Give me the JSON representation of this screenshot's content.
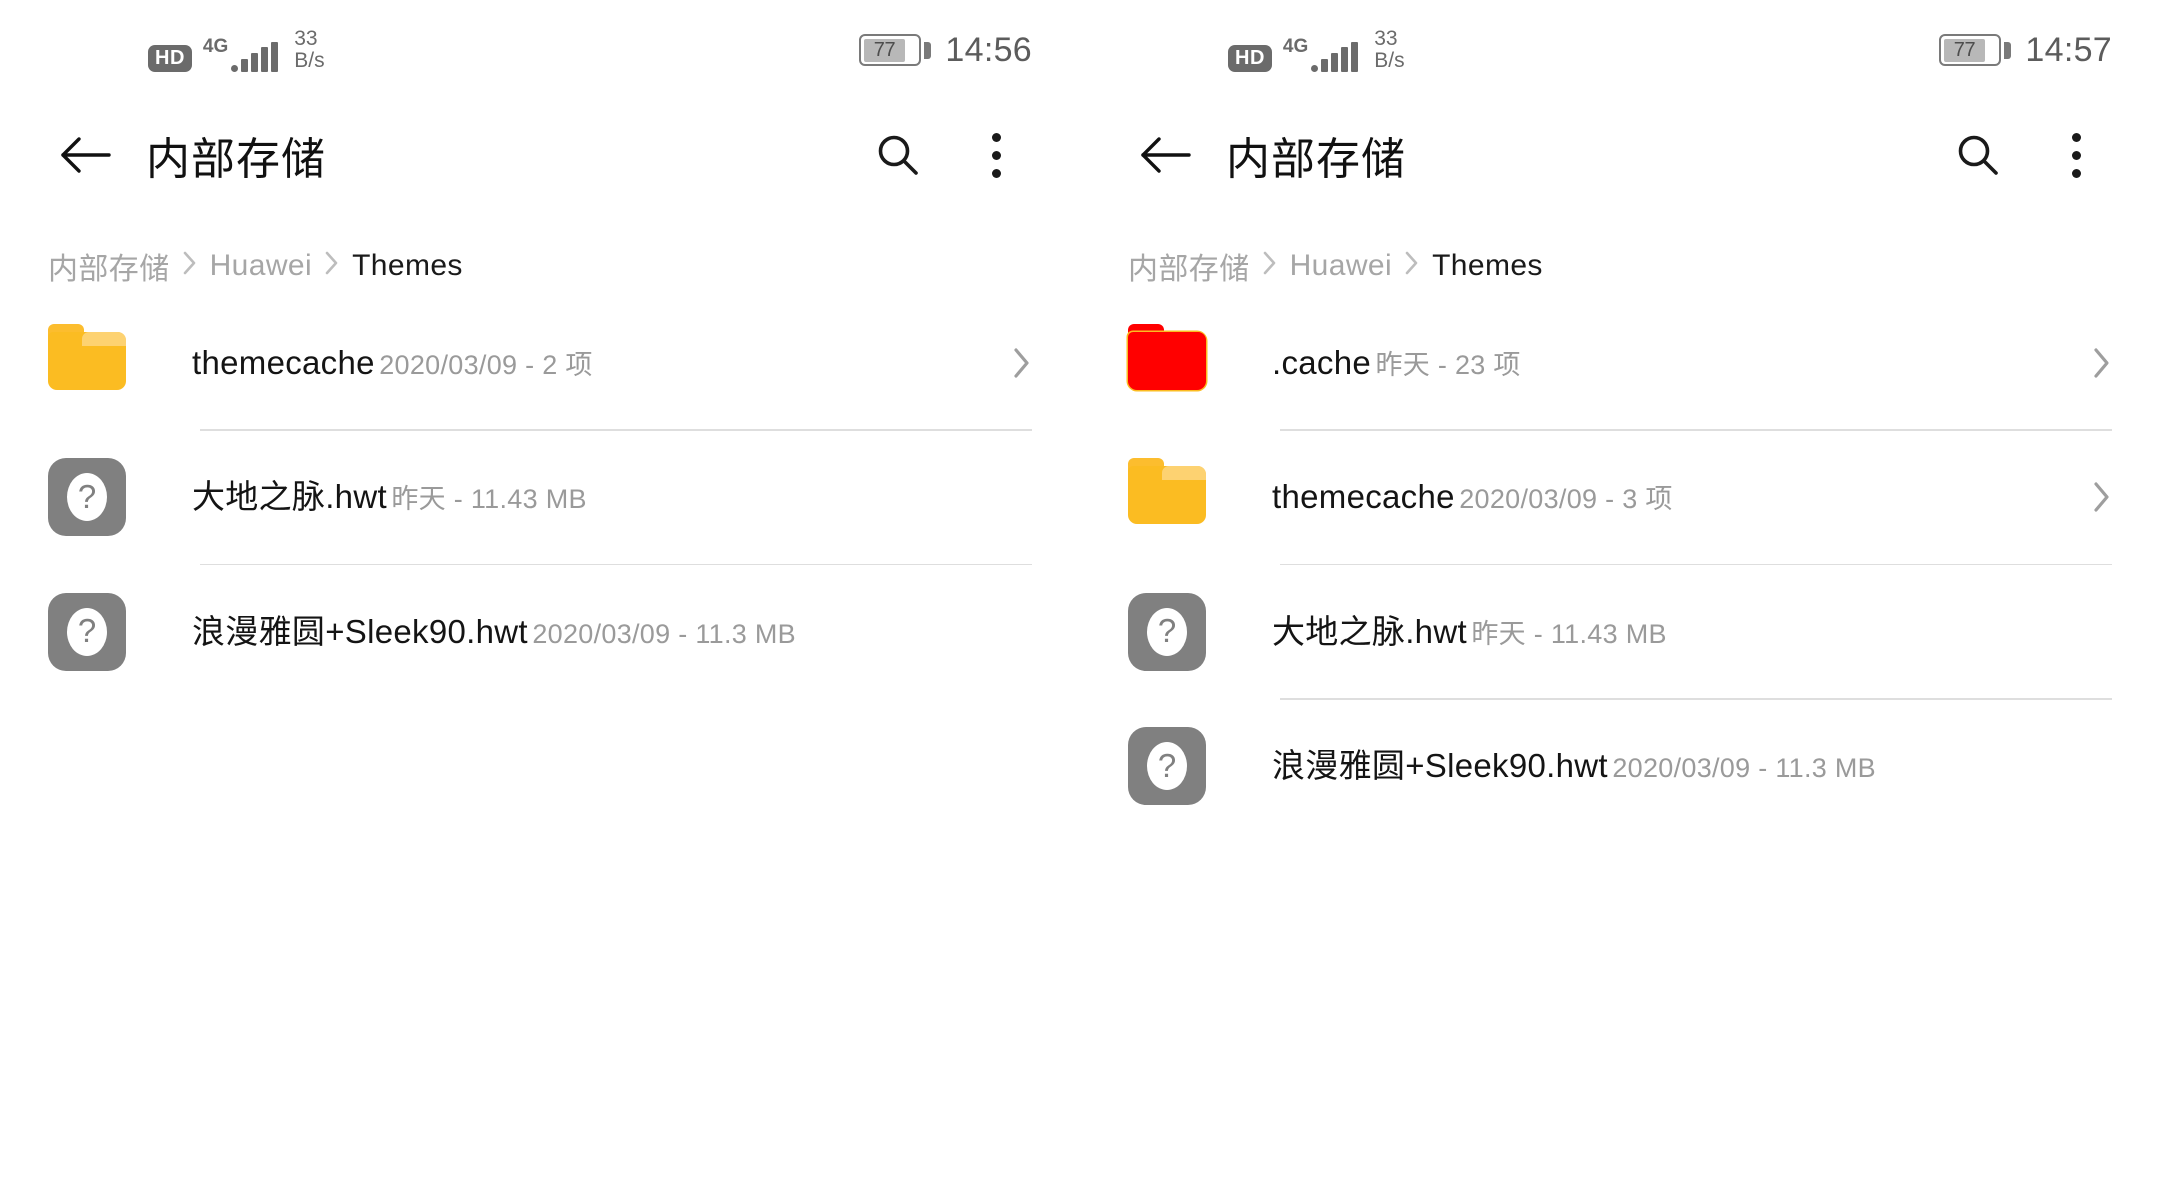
{
  "screens": [
    {
      "id": "before",
      "status_bar": {
        "hd_label": "HD",
        "network_gen": "4G",
        "signal_icon": "signal-bars-icon",
        "speed_value": "33",
        "speed_unit": "B/s",
        "battery_percent": "77",
        "battery_icon": "battery-icon",
        "time": "14:56"
      },
      "app_bar": {
        "back_icon": "back-arrow-icon",
        "title": "内部存储",
        "search_icon": "search-icon",
        "menu_icon": "more-vertical-icon"
      },
      "breadcrumb": {
        "separator": "›",
        "items": [
          {
            "label": "内部存储",
            "current": false
          },
          {
            "label": "Huawei",
            "current": false
          },
          {
            "label": "Themes",
            "current": true
          }
        ]
      },
      "files": [
        {
          "name": "themecache",
          "detail": "2020/03/09 - 2 项",
          "icon": "folder-icon",
          "icon_color": "#FBBC22",
          "has_chevron": true
        },
        {
          "name": "大地之脉.hwt",
          "detail": "昨天 - 11.43 MB",
          "icon": "unknown-file-icon",
          "icon_color": "#808080",
          "icon_glyph": "?",
          "has_chevron": false
        },
        {
          "name": "浪漫雅圆+Sleek90.hwt",
          "detail": "2020/03/09 - 11.3 MB",
          "icon": "unknown-file-icon",
          "icon_color": "#808080",
          "icon_glyph": "?",
          "has_chevron": false
        }
      ]
    },
    {
      "id": "after",
      "status_bar": {
        "hd_label": "HD",
        "network_gen": "4G",
        "signal_icon": "signal-bars-icon",
        "speed_value": "33",
        "speed_unit": "B/s",
        "battery_percent": "77",
        "battery_icon": "battery-icon",
        "time": "14:57"
      },
      "app_bar": {
        "back_icon": "back-arrow-icon",
        "title": "内部存储",
        "search_icon": "search-icon",
        "menu_icon": "more-vertical-icon"
      },
      "breadcrumb": {
        "separator": "›",
        "items": [
          {
            "label": "内部存储",
            "current": false
          },
          {
            "label": "Huawei",
            "current": false
          },
          {
            "label": "Themes",
            "current": true
          }
        ]
      },
      "files": [
        {
          "name": ".cache",
          "detail": "昨天 - 23 项",
          "icon": "folder-icon",
          "icon_color": "#FF0000",
          "highlighted": true,
          "has_chevron": true
        },
        {
          "name": "themecache",
          "detail": "2020/03/09 - 3 项",
          "icon": "folder-icon",
          "icon_color": "#FBBC22",
          "has_chevron": true
        },
        {
          "name": "大地之脉.hwt",
          "detail": "昨天 - 11.43 MB",
          "icon": "unknown-file-icon",
          "icon_color": "#808080",
          "icon_glyph": "?",
          "has_chevron": false
        },
        {
          "name": "浪漫雅圆+Sleek90.hwt",
          "detail": "2020/03/09 - 11.3 MB",
          "icon": "unknown-file-icon",
          "icon_color": "#808080",
          "icon_glyph": "?",
          "has_chevron": false
        }
      ]
    }
  ]
}
